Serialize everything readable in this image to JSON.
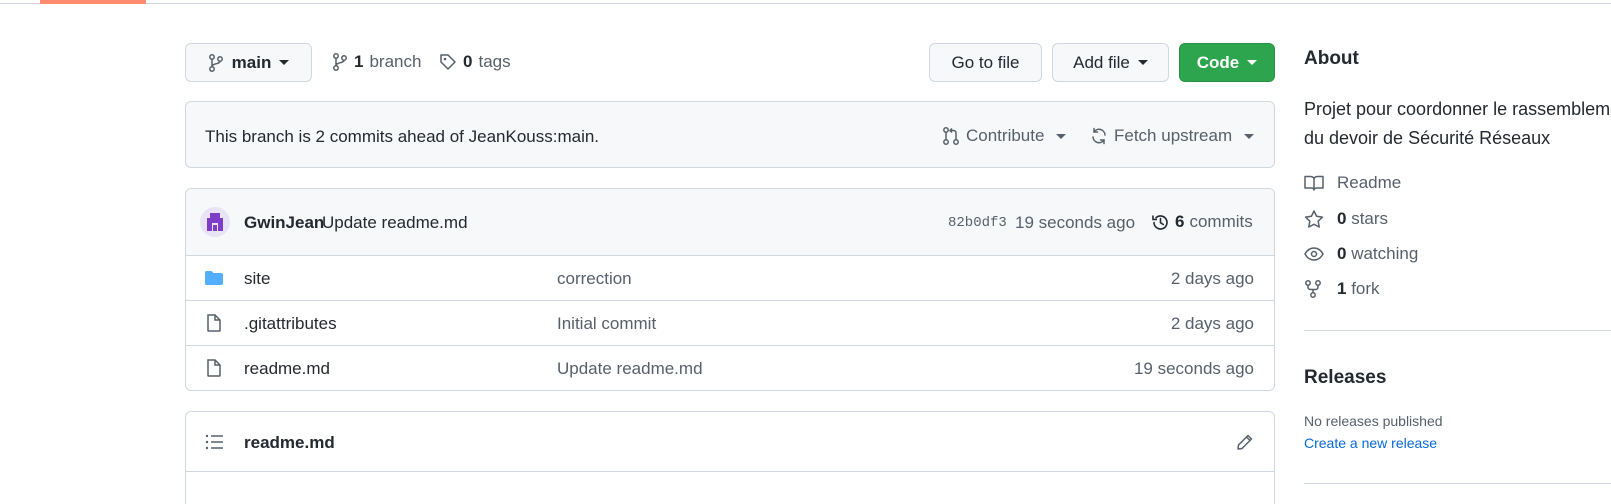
{
  "branch_selector": {
    "label": "main"
  },
  "branches": {
    "count": "1",
    "label": "branch"
  },
  "tags": {
    "count": "0",
    "label": "tags"
  },
  "actions": {
    "go_to_file": "Go to file",
    "add_file": "Add file",
    "code": "Code",
    "code_color": "#2da44e"
  },
  "ahead_banner": {
    "text": "This branch is 2 commits ahead of JeanKouss:main.",
    "contribute": "Contribute",
    "fetch_upstream": "Fetch upstream"
  },
  "latest_commit": {
    "author": "GwinJean",
    "message": "Update readme.md",
    "hash": "82b0df3",
    "time": "19 seconds ago",
    "commits_count": "6",
    "commits_label": "commits"
  },
  "files": [
    {
      "icon": "folder-icon",
      "name": "site",
      "message": "correction",
      "age": "2 days ago"
    },
    {
      "icon": "file-icon",
      "name": ".gitattributes",
      "message": "Initial commit",
      "age": "2 days ago"
    },
    {
      "icon": "file-icon",
      "name": "readme.md",
      "message": "Update readme.md",
      "age": "19 seconds ago"
    }
  ],
  "readme": {
    "title": "readme.md"
  },
  "about": {
    "title": "About",
    "description_line1": "Projet pour coordonner le rassemblement",
    "description_line2": "du devoir de Sécurité Réseaux",
    "readme_label": "Readme",
    "stars_count": "0",
    "stars_label": "stars",
    "watching_count": "0",
    "watching_label": "watching",
    "fork_count": "1",
    "fork_label": "fork"
  },
  "releases": {
    "title": "Releases",
    "none_text": "No releases published",
    "create_link": "Create a new release"
  }
}
